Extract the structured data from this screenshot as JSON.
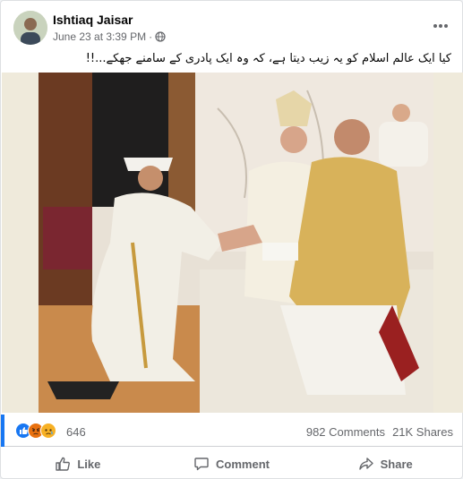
{
  "post": {
    "author": "Ishtiaq Jaisar",
    "timestamp": "June 23 at 3:39 PM",
    "separator": "·",
    "privacy_icon": "globe-icon",
    "caption": "کیا ایک عالم اسلام کو یہ زیب دیتا ہے، کہ وہ ایک پادری کے سامنے جھکے...!!"
  },
  "stats": {
    "reactions": [
      "like-icon",
      "angry-icon",
      "sad-icon"
    ],
    "reaction_count": "646",
    "comments": "982 Comments",
    "shares": "21K Shares"
  },
  "actions": {
    "like": "Like",
    "comment": "Comment",
    "share": "Share"
  },
  "colors": {
    "brand_blue": "#1877f2",
    "secondary_text": "#65676b",
    "angry": "#e9710f",
    "sad": "#f7b125"
  }
}
